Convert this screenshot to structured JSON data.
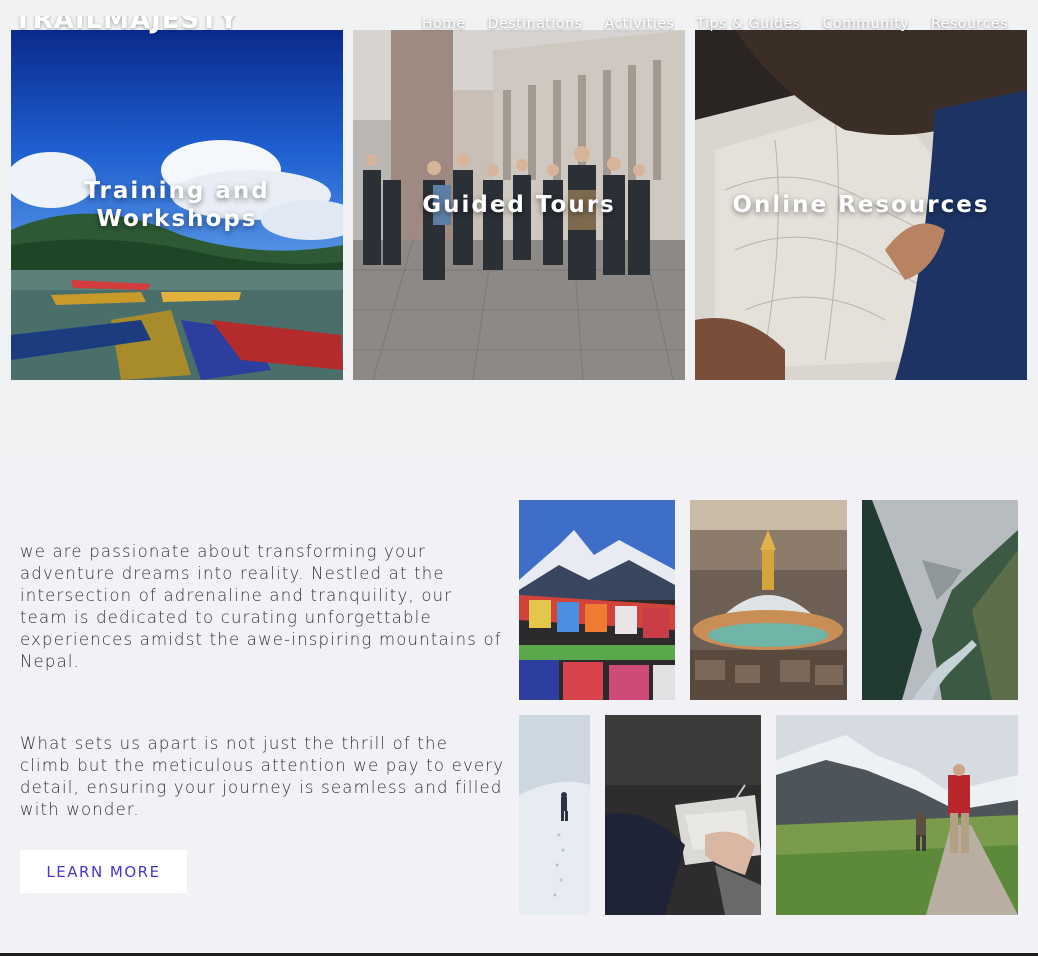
{
  "brand": {
    "logo_text": "TRAILMAJESTY"
  },
  "nav": {
    "items": [
      {
        "label": "Home"
      },
      {
        "label": "Destinations"
      },
      {
        "label": "Activities"
      },
      {
        "label": "Tips & Guides"
      },
      {
        "label": "Community"
      },
      {
        "label": "Resources"
      }
    ]
  },
  "cards": [
    {
      "title": "Training and Workshops",
      "image": "lake-boats-image"
    },
    {
      "title": "Guided Tours",
      "image": "city-tour-group-image"
    },
    {
      "title": "Online Resources",
      "image": "map-reading-image"
    }
  ],
  "about": {
    "paragraph1": "we are passionate about transforming your adventure dreams into reality. Nestled at the intersection of adrenaline and tranquility, our team is dedicated to curating unforgettable experiences amidst the awe-inspiring mountains of Nepal.",
    "paragraph2": "What sets us apart is not just the thrill of the climb but the meticulous attention we pay to every detail, ensuring your journey is seamless and filled with wonder.",
    "button_label": "LEARN MORE"
  },
  "gallery": [
    {
      "name": "prayer-flags-mountain-image"
    },
    {
      "name": "stupa-city-image"
    },
    {
      "name": "valley-river-image"
    },
    {
      "name": "snow-climber-image"
    },
    {
      "name": "notebook-writing-image"
    },
    {
      "name": "hikers-trail-image"
    }
  ],
  "colors": {
    "accent": "#4336c9",
    "section_bg": "#f2f1f5",
    "page_bg": "#f1f2f4"
  }
}
